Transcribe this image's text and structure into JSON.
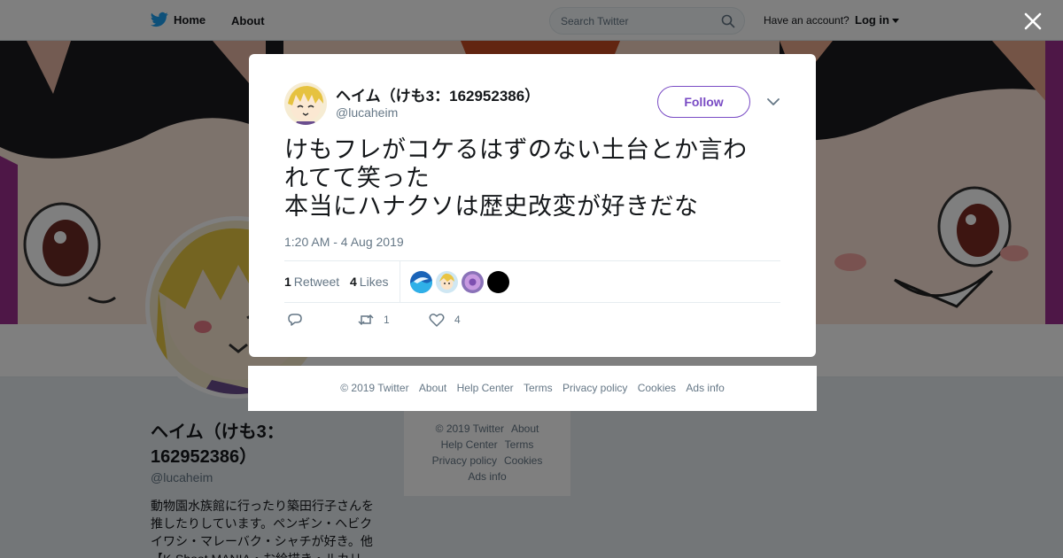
{
  "topbar": {
    "home_label": "Home",
    "about_label": "About",
    "search_placeholder": "Search Twitter",
    "have_account": "Have an account?",
    "login_label": "Log in"
  },
  "profile": {
    "name": "ヘイム（けも3：162952386）",
    "handle": "@lucaheim",
    "bio": "動物園水族館に行ったり築田行子さんを推したりしています。ペンギン・ヘビクイワシ・マレーバク・シャチが好き。他【K-Shoot MANIA・お絵描き・ルカリ"
  },
  "side_footer": {
    "links": [
      "© 2019 Twitter",
      "About",
      "Help Center",
      "Terms",
      "Privacy policy",
      "Cookies",
      "Ads info"
    ]
  },
  "tweet": {
    "author_name": "ヘイム（けも3：162952386）",
    "author_handle": "@lucaheim",
    "follow_label": "Follow",
    "text_lines": [
      "けもフレがコケるはずのない土台とか言わ",
      "れてて笑った",
      "本当にハナクソは歴史改変が好きだな"
    ],
    "timestamp": "1:20 AM - 4 Aug 2019",
    "retweet_count": "1",
    "retweet_label": "Retweet",
    "likes_count": "4",
    "likes_label": "Likes",
    "action_retweet_count": "1",
    "action_like_count": "4"
  },
  "footer": {
    "links": [
      "© 2019 Twitter",
      "About",
      "Help Center",
      "Terms",
      "Privacy policy",
      "Cookies",
      "Ads info"
    ]
  },
  "icons": [
    "twitter-bird-icon",
    "search-icon",
    "caret-down-icon",
    "close-icon",
    "chevron-down-icon",
    "reply-icon",
    "retweet-icon",
    "like-icon"
  ],
  "colors": {
    "accent_purple": "#794bc4",
    "twitter_blue": "#1da1f2",
    "text_dark": "#14171a",
    "text_muted": "#657786"
  }
}
